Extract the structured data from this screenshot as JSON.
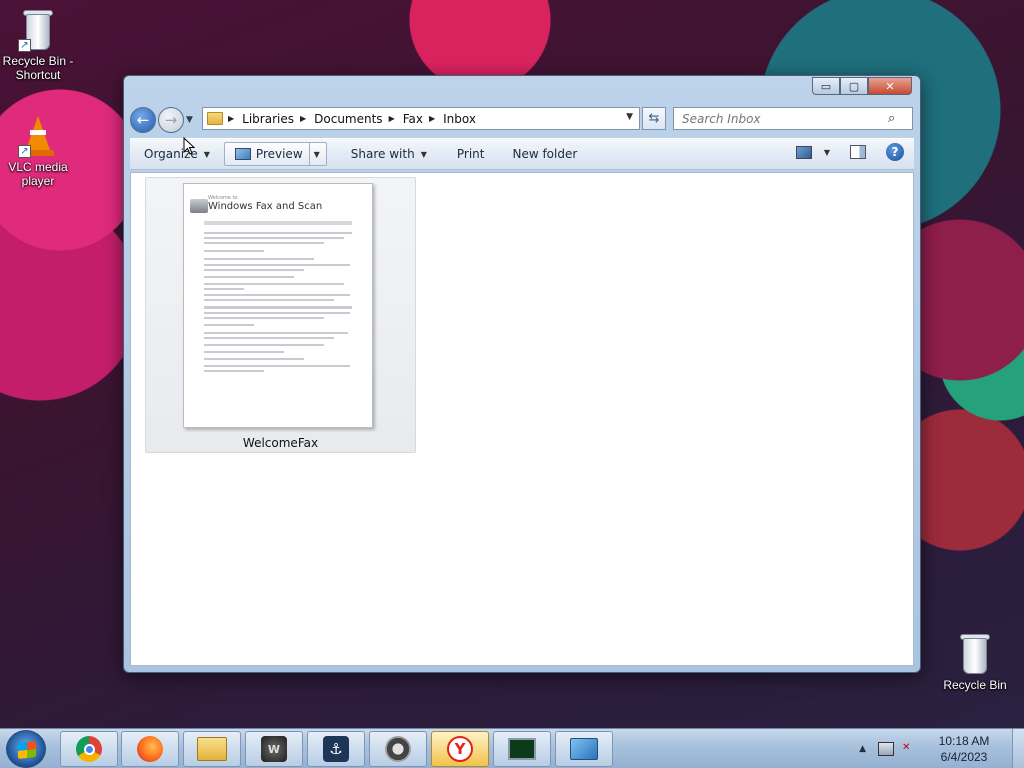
{
  "desktop": {
    "icons": [
      {
        "label": "Recycle Bin - Shortcut"
      },
      {
        "label": "VLC media player"
      },
      {
        "label": "Recycle Bin"
      }
    ]
  },
  "window": {
    "controls": {
      "minimize": "▭",
      "maximize": "▢",
      "close": "✕"
    },
    "nav": {
      "back": "←",
      "forward": "→"
    },
    "address": {
      "crumbs": [
        "Libraries",
        "Documents",
        "Fax",
        "Inbox"
      ]
    },
    "search": {
      "placeholder": "Search Inbox"
    },
    "toolbar": {
      "organize": "Organize",
      "preview": "Preview",
      "share_with": "Share with",
      "print": "Print",
      "new_folder": "New folder",
      "help": "?"
    },
    "files": [
      {
        "name": "WelcomeFax",
        "thumb_small": "Welcome to",
        "thumb_title": "Windows Fax and Scan"
      }
    ]
  },
  "taskbar": {
    "apps": [
      {
        "name": "chrome-icon",
        "glyph": ""
      },
      {
        "name": "firefox-icon",
        "glyph": ""
      },
      {
        "name": "file-explorer-icon",
        "glyph": ""
      },
      {
        "name": "world-of-tanks-icon",
        "glyph": ""
      },
      {
        "name": "world-of-warships-icon",
        "glyph": "⚓"
      },
      {
        "name": "raccoon-app-icon",
        "glyph": ""
      },
      {
        "name": "yandex-browser-icon",
        "glyph": "Y"
      },
      {
        "name": "task-manager-icon",
        "glyph": ""
      },
      {
        "name": "control-panel-icon",
        "glyph": ""
      }
    ],
    "clock": {
      "time": "10:18 AM",
      "date": "6/4/2023"
    }
  }
}
